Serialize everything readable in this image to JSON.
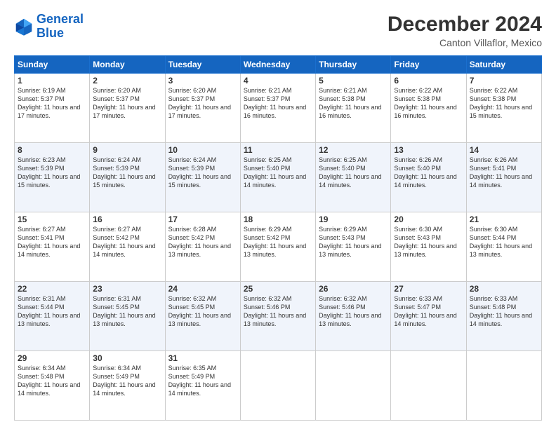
{
  "header": {
    "logo_line1": "General",
    "logo_line2": "Blue",
    "title": "December 2024",
    "subtitle": "Canton Villaflor, Mexico"
  },
  "weekdays": [
    "Sunday",
    "Monday",
    "Tuesday",
    "Wednesday",
    "Thursday",
    "Friday",
    "Saturday"
  ],
  "weeks": [
    [
      {
        "day": "1",
        "info": "Sunrise: 6:19 AM\nSunset: 5:37 PM\nDaylight: 11 hours and 17 minutes."
      },
      {
        "day": "2",
        "info": "Sunrise: 6:20 AM\nSunset: 5:37 PM\nDaylight: 11 hours and 17 minutes."
      },
      {
        "day": "3",
        "info": "Sunrise: 6:20 AM\nSunset: 5:37 PM\nDaylight: 11 hours and 17 minutes."
      },
      {
        "day": "4",
        "info": "Sunrise: 6:21 AM\nSunset: 5:37 PM\nDaylight: 11 hours and 16 minutes."
      },
      {
        "day": "5",
        "info": "Sunrise: 6:21 AM\nSunset: 5:38 PM\nDaylight: 11 hours and 16 minutes."
      },
      {
        "day": "6",
        "info": "Sunrise: 6:22 AM\nSunset: 5:38 PM\nDaylight: 11 hours and 16 minutes."
      },
      {
        "day": "7",
        "info": "Sunrise: 6:22 AM\nSunset: 5:38 PM\nDaylight: 11 hours and 15 minutes."
      }
    ],
    [
      {
        "day": "8",
        "info": "Sunrise: 6:23 AM\nSunset: 5:39 PM\nDaylight: 11 hours and 15 minutes."
      },
      {
        "day": "9",
        "info": "Sunrise: 6:24 AM\nSunset: 5:39 PM\nDaylight: 11 hours and 15 minutes."
      },
      {
        "day": "10",
        "info": "Sunrise: 6:24 AM\nSunset: 5:39 PM\nDaylight: 11 hours and 15 minutes."
      },
      {
        "day": "11",
        "info": "Sunrise: 6:25 AM\nSunset: 5:40 PM\nDaylight: 11 hours and 14 minutes."
      },
      {
        "day": "12",
        "info": "Sunrise: 6:25 AM\nSunset: 5:40 PM\nDaylight: 11 hours and 14 minutes."
      },
      {
        "day": "13",
        "info": "Sunrise: 6:26 AM\nSunset: 5:40 PM\nDaylight: 11 hours and 14 minutes."
      },
      {
        "day": "14",
        "info": "Sunrise: 6:26 AM\nSunset: 5:41 PM\nDaylight: 11 hours and 14 minutes."
      }
    ],
    [
      {
        "day": "15",
        "info": "Sunrise: 6:27 AM\nSunset: 5:41 PM\nDaylight: 11 hours and 14 minutes."
      },
      {
        "day": "16",
        "info": "Sunrise: 6:27 AM\nSunset: 5:42 PM\nDaylight: 11 hours and 14 minutes."
      },
      {
        "day": "17",
        "info": "Sunrise: 6:28 AM\nSunset: 5:42 PM\nDaylight: 11 hours and 13 minutes."
      },
      {
        "day": "18",
        "info": "Sunrise: 6:29 AM\nSunset: 5:42 PM\nDaylight: 11 hours and 13 minutes."
      },
      {
        "day": "19",
        "info": "Sunrise: 6:29 AM\nSunset: 5:43 PM\nDaylight: 11 hours and 13 minutes."
      },
      {
        "day": "20",
        "info": "Sunrise: 6:30 AM\nSunset: 5:43 PM\nDaylight: 11 hours and 13 minutes."
      },
      {
        "day": "21",
        "info": "Sunrise: 6:30 AM\nSunset: 5:44 PM\nDaylight: 11 hours and 13 minutes."
      }
    ],
    [
      {
        "day": "22",
        "info": "Sunrise: 6:31 AM\nSunset: 5:44 PM\nDaylight: 11 hours and 13 minutes."
      },
      {
        "day": "23",
        "info": "Sunrise: 6:31 AM\nSunset: 5:45 PM\nDaylight: 11 hours and 13 minutes."
      },
      {
        "day": "24",
        "info": "Sunrise: 6:32 AM\nSunset: 5:45 PM\nDaylight: 11 hours and 13 minutes."
      },
      {
        "day": "25",
        "info": "Sunrise: 6:32 AM\nSunset: 5:46 PM\nDaylight: 11 hours and 13 minutes."
      },
      {
        "day": "26",
        "info": "Sunrise: 6:32 AM\nSunset: 5:46 PM\nDaylight: 11 hours and 13 minutes."
      },
      {
        "day": "27",
        "info": "Sunrise: 6:33 AM\nSunset: 5:47 PM\nDaylight: 11 hours and 14 minutes."
      },
      {
        "day": "28",
        "info": "Sunrise: 6:33 AM\nSunset: 5:48 PM\nDaylight: 11 hours and 14 minutes."
      }
    ],
    [
      {
        "day": "29",
        "info": "Sunrise: 6:34 AM\nSunset: 5:48 PM\nDaylight: 11 hours and 14 minutes."
      },
      {
        "day": "30",
        "info": "Sunrise: 6:34 AM\nSunset: 5:49 PM\nDaylight: 11 hours and 14 minutes."
      },
      {
        "day": "31",
        "info": "Sunrise: 6:35 AM\nSunset: 5:49 PM\nDaylight: 11 hours and 14 minutes."
      },
      null,
      null,
      null,
      null
    ]
  ]
}
